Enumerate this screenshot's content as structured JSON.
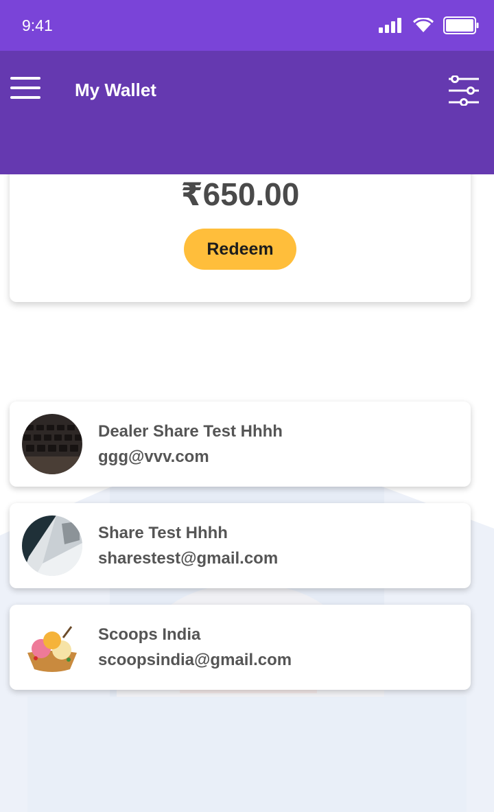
{
  "status_bar": {
    "time": "9:41",
    "icons": [
      "signal-icon",
      "wifi-icon",
      "battery-icon"
    ]
  },
  "header": {
    "title": "My Wallet",
    "menu_icon": "menu-icon",
    "filter_icon": "filter-icon"
  },
  "wallet": {
    "balance": "₹650.00",
    "redeem_label": "Redeem"
  },
  "dealers": [
    {
      "name": "Dealer Share Test Hhhh",
      "email": "ggg@vvv.com",
      "avatar": "keyboard-photo"
    },
    {
      "name": "Share Test Hhhh",
      "email": "sharestest@gmail.com",
      "avatar": "laptop-photo"
    },
    {
      "name": "Scoops India",
      "email": "scoopsindia@gmail.com",
      "avatar": "ice-cream-photo"
    }
  ],
  "colors": {
    "status_bar": "#7a44d8",
    "header": "#6539b0",
    "accent": "#ffbe3b",
    "text": "#555555",
    "page_bg": "#ffffff"
  }
}
